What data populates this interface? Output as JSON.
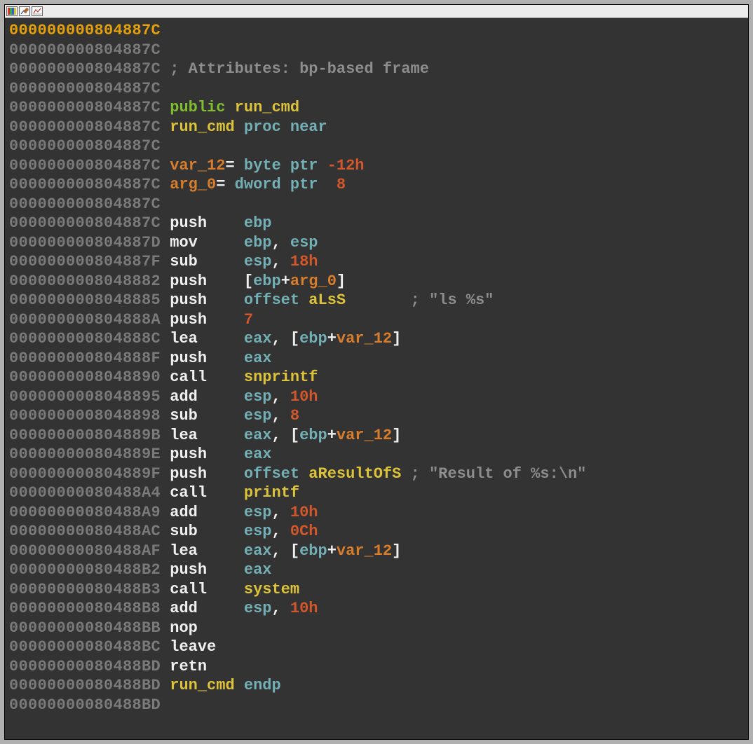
{
  "toolbar": {
    "icons": [
      "color-bars-icon",
      "pencil-graph-icon",
      "line-chart-icon"
    ]
  },
  "lines": [
    {
      "addr": "000000000804887C",
      "addrClass": "addr-hi",
      "tokens": []
    },
    {
      "addr": "000000000804887C",
      "addrClass": "addr",
      "tokens": []
    },
    {
      "addr": "000000000804887C",
      "addrClass": "addr",
      "tokens": [
        {
          "t": " ",
          "c": "gray"
        },
        {
          "t": "; Attributes: bp-based frame",
          "c": "gray"
        }
      ]
    },
    {
      "addr": "000000000804887C",
      "addrClass": "addr",
      "tokens": []
    },
    {
      "addr": "000000000804887C",
      "addrClass": "addr",
      "tokens": [
        {
          "t": " ",
          "c": "white"
        },
        {
          "t": "public",
          "c": "green"
        },
        {
          "t": " ",
          "c": "white"
        },
        {
          "t": "run_cmd",
          "c": "yellow"
        }
      ]
    },
    {
      "addr": "000000000804887C",
      "addrClass": "addr",
      "tokens": [
        {
          "t": " ",
          "c": "white"
        },
        {
          "t": "run_cmd",
          "c": "yellow"
        },
        {
          "t": " ",
          "c": "white"
        },
        {
          "t": "proc",
          "c": "cyan"
        },
        {
          "t": " ",
          "c": "white"
        },
        {
          "t": "near",
          "c": "cyan"
        }
      ]
    },
    {
      "addr": "000000000804887C",
      "addrClass": "addr",
      "tokens": []
    },
    {
      "addr": "000000000804887C",
      "addrClass": "addr",
      "tokens": [
        {
          "t": " ",
          "c": "white"
        },
        {
          "t": "var_12",
          "c": "orange"
        },
        {
          "t": "= ",
          "c": "white"
        },
        {
          "t": "byte ptr",
          "c": "cyan"
        },
        {
          "t": " ",
          "c": "white"
        },
        {
          "t": "-12h",
          "c": "red"
        }
      ]
    },
    {
      "addr": "000000000804887C",
      "addrClass": "addr",
      "tokens": [
        {
          "t": " ",
          "c": "white"
        },
        {
          "t": "arg_0",
          "c": "orange"
        },
        {
          "t": "= ",
          "c": "white"
        },
        {
          "t": "dword ptr",
          "c": "cyan"
        },
        {
          "t": "  ",
          "c": "white"
        },
        {
          "t": "8",
          "c": "red"
        }
      ]
    },
    {
      "addr": "000000000804887C",
      "addrClass": "addr",
      "tokens": []
    },
    {
      "addr": "000000000804887C",
      "addrClass": "addr",
      "tokens": [
        {
          "t": " ",
          "c": "white"
        },
        {
          "t": "push",
          "c": "white"
        },
        {
          "t": "    ",
          "c": "white"
        },
        {
          "t": "ebp",
          "c": "cyan"
        }
      ]
    },
    {
      "addr": "000000000804887D",
      "addrClass": "addr",
      "tokens": [
        {
          "t": " ",
          "c": "white"
        },
        {
          "t": "mov",
          "c": "white"
        },
        {
          "t": "     ",
          "c": "white"
        },
        {
          "t": "ebp",
          "c": "cyan"
        },
        {
          "t": ", ",
          "c": "white"
        },
        {
          "t": "esp",
          "c": "cyan"
        }
      ]
    },
    {
      "addr": "000000000804887F",
      "addrClass": "addr",
      "tokens": [
        {
          "t": " ",
          "c": "white"
        },
        {
          "t": "sub",
          "c": "white"
        },
        {
          "t": "     ",
          "c": "white"
        },
        {
          "t": "esp",
          "c": "cyan"
        },
        {
          "t": ", ",
          "c": "white"
        },
        {
          "t": "18h",
          "c": "red"
        }
      ]
    },
    {
      "addr": "0000000008048882",
      "addrClass": "addr",
      "tokens": [
        {
          "t": " ",
          "c": "white"
        },
        {
          "t": "push",
          "c": "white"
        },
        {
          "t": "    [",
          "c": "white"
        },
        {
          "t": "ebp",
          "c": "cyan"
        },
        {
          "t": "+",
          "c": "white"
        },
        {
          "t": "arg_0",
          "c": "orange"
        },
        {
          "t": "]",
          "c": "white"
        }
      ]
    },
    {
      "addr": "0000000008048885",
      "addrClass": "addr",
      "tokens": [
        {
          "t": " ",
          "c": "white"
        },
        {
          "t": "push",
          "c": "white"
        },
        {
          "t": "    ",
          "c": "white"
        },
        {
          "t": "offset",
          "c": "cyan"
        },
        {
          "t": " ",
          "c": "white"
        },
        {
          "t": "aLsS",
          "c": "yellow"
        },
        {
          "t": "       ; ",
          "c": "gray"
        },
        {
          "t": "\"ls %s\"",
          "c": "gray"
        }
      ]
    },
    {
      "addr": "000000000804888A",
      "addrClass": "addr",
      "tokens": [
        {
          "t": " ",
          "c": "white"
        },
        {
          "t": "push",
          "c": "white"
        },
        {
          "t": "    ",
          "c": "white"
        },
        {
          "t": "7",
          "c": "red"
        }
      ]
    },
    {
      "addr": "000000000804888C",
      "addrClass": "addr",
      "tokens": [
        {
          "t": " ",
          "c": "white"
        },
        {
          "t": "lea",
          "c": "white"
        },
        {
          "t": "     ",
          "c": "white"
        },
        {
          "t": "eax",
          "c": "cyan"
        },
        {
          "t": ", [",
          "c": "white"
        },
        {
          "t": "ebp",
          "c": "cyan"
        },
        {
          "t": "+",
          "c": "white"
        },
        {
          "t": "var_12",
          "c": "orange"
        },
        {
          "t": "]",
          "c": "white"
        }
      ]
    },
    {
      "addr": "000000000804888F",
      "addrClass": "addr",
      "tokens": [
        {
          "t": " ",
          "c": "white"
        },
        {
          "t": "push",
          "c": "white"
        },
        {
          "t": "    ",
          "c": "white"
        },
        {
          "t": "eax",
          "c": "cyan"
        }
      ]
    },
    {
      "addr": "0000000008048890",
      "addrClass": "addr",
      "tokens": [
        {
          "t": " ",
          "c": "white"
        },
        {
          "t": "call",
          "c": "white"
        },
        {
          "t": "    ",
          "c": "white"
        },
        {
          "t": "snprintf",
          "c": "yellow"
        }
      ]
    },
    {
      "addr": "0000000008048895",
      "addrClass": "addr",
      "tokens": [
        {
          "t": " ",
          "c": "white"
        },
        {
          "t": "add",
          "c": "white"
        },
        {
          "t": "     ",
          "c": "white"
        },
        {
          "t": "esp",
          "c": "cyan"
        },
        {
          "t": ", ",
          "c": "white"
        },
        {
          "t": "10h",
          "c": "red"
        }
      ]
    },
    {
      "addr": "0000000008048898",
      "addrClass": "addr",
      "tokens": [
        {
          "t": " ",
          "c": "white"
        },
        {
          "t": "sub",
          "c": "white"
        },
        {
          "t": "     ",
          "c": "white"
        },
        {
          "t": "esp",
          "c": "cyan"
        },
        {
          "t": ", ",
          "c": "white"
        },
        {
          "t": "8",
          "c": "red"
        }
      ]
    },
    {
      "addr": "000000000804889B",
      "addrClass": "addr",
      "tokens": [
        {
          "t": " ",
          "c": "white"
        },
        {
          "t": "lea",
          "c": "white"
        },
        {
          "t": "     ",
          "c": "white"
        },
        {
          "t": "eax",
          "c": "cyan"
        },
        {
          "t": ", [",
          "c": "white"
        },
        {
          "t": "ebp",
          "c": "cyan"
        },
        {
          "t": "+",
          "c": "white"
        },
        {
          "t": "var_12",
          "c": "orange"
        },
        {
          "t": "]",
          "c": "white"
        }
      ]
    },
    {
      "addr": "000000000804889E",
      "addrClass": "addr",
      "tokens": [
        {
          "t": " ",
          "c": "white"
        },
        {
          "t": "push",
          "c": "white"
        },
        {
          "t": "    ",
          "c": "white"
        },
        {
          "t": "eax",
          "c": "cyan"
        }
      ]
    },
    {
      "addr": "000000000804889F",
      "addrClass": "addr",
      "tokens": [
        {
          "t": " ",
          "c": "white"
        },
        {
          "t": "push",
          "c": "white"
        },
        {
          "t": "    ",
          "c": "white"
        },
        {
          "t": "offset",
          "c": "cyan"
        },
        {
          "t": " ",
          "c": "white"
        },
        {
          "t": "aResultOfS",
          "c": "yellow"
        },
        {
          "t": " ; ",
          "c": "gray"
        },
        {
          "t": "\"Result of %s:\\n\"",
          "c": "gray"
        }
      ]
    },
    {
      "addr": "00000000080488A4",
      "addrClass": "addr",
      "tokens": [
        {
          "t": " ",
          "c": "white"
        },
        {
          "t": "call",
          "c": "white"
        },
        {
          "t": "    ",
          "c": "white"
        },
        {
          "t": "printf",
          "c": "yellow"
        }
      ]
    },
    {
      "addr": "00000000080488A9",
      "addrClass": "addr",
      "tokens": [
        {
          "t": " ",
          "c": "white"
        },
        {
          "t": "add",
          "c": "white"
        },
        {
          "t": "     ",
          "c": "white"
        },
        {
          "t": "esp",
          "c": "cyan"
        },
        {
          "t": ", ",
          "c": "white"
        },
        {
          "t": "10h",
          "c": "red"
        }
      ]
    },
    {
      "addr": "00000000080488AC",
      "addrClass": "addr",
      "tokens": [
        {
          "t": " ",
          "c": "white"
        },
        {
          "t": "sub",
          "c": "white"
        },
        {
          "t": "     ",
          "c": "white"
        },
        {
          "t": "esp",
          "c": "cyan"
        },
        {
          "t": ", ",
          "c": "white"
        },
        {
          "t": "0Ch",
          "c": "red"
        }
      ]
    },
    {
      "addr": "00000000080488AF",
      "addrClass": "addr",
      "tokens": [
        {
          "t": " ",
          "c": "white"
        },
        {
          "t": "lea",
          "c": "white"
        },
        {
          "t": "     ",
          "c": "white"
        },
        {
          "t": "eax",
          "c": "cyan"
        },
        {
          "t": ", [",
          "c": "white"
        },
        {
          "t": "ebp",
          "c": "cyan"
        },
        {
          "t": "+",
          "c": "white"
        },
        {
          "t": "var_12",
          "c": "orange"
        },
        {
          "t": "]",
          "c": "white"
        }
      ]
    },
    {
      "addr": "00000000080488B2",
      "addrClass": "addr",
      "tokens": [
        {
          "t": " ",
          "c": "white"
        },
        {
          "t": "push",
          "c": "white"
        },
        {
          "t": "    ",
          "c": "white"
        },
        {
          "t": "eax",
          "c": "cyan"
        }
      ]
    },
    {
      "addr": "00000000080488B3",
      "addrClass": "addr",
      "tokens": [
        {
          "t": " ",
          "c": "white"
        },
        {
          "t": "call",
          "c": "white"
        },
        {
          "t": "    ",
          "c": "white"
        },
        {
          "t": "system",
          "c": "yellow"
        }
      ]
    },
    {
      "addr": "00000000080488B8",
      "addrClass": "addr",
      "tokens": [
        {
          "t": " ",
          "c": "white"
        },
        {
          "t": "add",
          "c": "white"
        },
        {
          "t": "     ",
          "c": "white"
        },
        {
          "t": "esp",
          "c": "cyan"
        },
        {
          "t": ", ",
          "c": "white"
        },
        {
          "t": "10h",
          "c": "red"
        }
      ]
    },
    {
      "addr": "00000000080488BB",
      "addrClass": "addr",
      "tokens": [
        {
          "t": " ",
          "c": "white"
        },
        {
          "t": "nop",
          "c": "white"
        }
      ]
    },
    {
      "addr": "00000000080488BC",
      "addrClass": "addr",
      "tokens": [
        {
          "t": " ",
          "c": "white"
        },
        {
          "t": "leave",
          "c": "white"
        }
      ]
    },
    {
      "addr": "00000000080488BD",
      "addrClass": "addr",
      "tokens": [
        {
          "t": " ",
          "c": "white"
        },
        {
          "t": "retn",
          "c": "white"
        }
      ]
    },
    {
      "addr": "00000000080488BD",
      "addrClass": "addr",
      "tokens": [
        {
          "t": " ",
          "c": "white"
        },
        {
          "t": "run_cmd",
          "c": "yellow"
        },
        {
          "t": " ",
          "c": "white"
        },
        {
          "t": "endp",
          "c": "cyan"
        }
      ]
    },
    {
      "addr": "00000000080488BD",
      "addrClass": "addr",
      "tokens": []
    }
  ]
}
